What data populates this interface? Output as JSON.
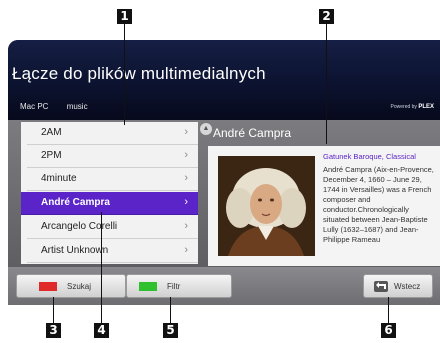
{
  "markers": [
    "1",
    "2",
    "3",
    "4",
    "5",
    "6"
  ],
  "header": {
    "title": "Łącze do plików multimedialnych",
    "breadcrumb": [
      "Mac PC",
      "music"
    ],
    "powered_by_prefix": "Powered by",
    "powered_by_brand": "PLEX"
  },
  "list": {
    "items": [
      {
        "label": "2AM",
        "selected": false
      },
      {
        "label": "2PM",
        "selected": false
      },
      {
        "label": "4minute",
        "selected": false
      },
      {
        "label": "André Campra",
        "selected": true
      },
      {
        "label": "Arcangelo Corelli",
        "selected": false
      },
      {
        "label": "Artist Unknown",
        "selected": false
      }
    ],
    "chevron": "›",
    "scroll_icon": "scroll-arrows-icon"
  },
  "detail": {
    "title": "André Campra",
    "genre": "Gatunek  Baroque, Classical",
    "description": "André Campra (Aix-en-Provence, December 4, 1660 – June 29, 1744 in Versailles) was a French composer and conductor.Chronologically situated between Jean-Baptiste Lully (1632–1687) and Jean-Philippe Rameau"
  },
  "buttons": {
    "search": {
      "label": "Szukaj",
      "color": "#e02a2a"
    },
    "filter": {
      "label": "Filtr",
      "color": "#2ec02e"
    },
    "back": {
      "label": "Wstecz",
      "icon": "return-icon"
    }
  },
  "colors": {
    "selection": "#5b24c9",
    "header": "#0c1330"
  }
}
